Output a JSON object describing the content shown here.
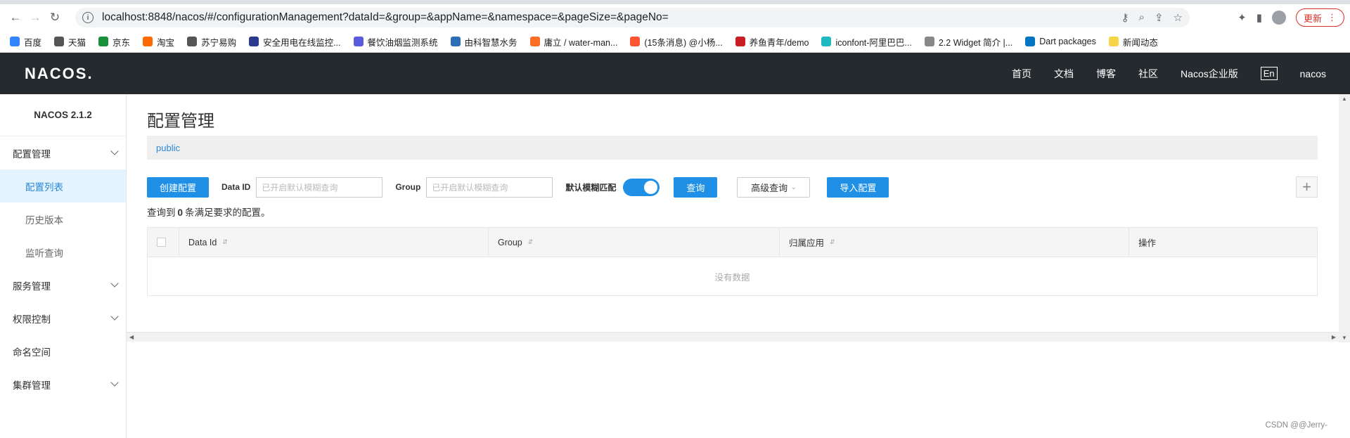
{
  "browser": {
    "url": "localhost:8848/nacos/#/configurationManagement?dataId=&group=&appName=&namespace=&pageSize=&pageNo=",
    "update_label": "更新",
    "bookmarks": [
      {
        "label": "百度",
        "color": "#3385ff"
      },
      {
        "label": "天猫",
        "color": "#555555"
      },
      {
        "label": "京东",
        "color": "#1a8f3c"
      },
      {
        "label": "淘宝",
        "color": "#ff6a00"
      },
      {
        "label": "苏宁易购",
        "color": "#555555"
      },
      {
        "label": "安全用电在线监控...",
        "color": "#2a3a8c"
      },
      {
        "label": "餐饮油烟监测系统",
        "color": "#5a5adc"
      },
      {
        "label": "由科智慧水务",
        "color": "#2a6fb8"
      },
      {
        "label": "庸立 / water-man...",
        "color": "#fc6d26"
      },
      {
        "label": "(15条消息) @小杨...",
        "color": "#fc5531"
      },
      {
        "label": "养鱼青年/demo",
        "color": "#c71d23"
      },
      {
        "label": "iconfont-阿里巴巴...",
        "color": "#1fb8c3"
      },
      {
        "label": "2.2 Widget 简介 |...",
        "color": "#888888"
      },
      {
        "label": "Dart packages",
        "color": "#0175c2"
      },
      {
        "label": "新闻动态",
        "color": "#f5d547"
      }
    ]
  },
  "header": {
    "logo": "NACOS.",
    "nav": [
      "首页",
      "文档",
      "博客",
      "社区",
      "Nacos企业版"
    ],
    "lang": "En",
    "user": "nacos"
  },
  "sidebar": {
    "version": "NACOS 2.1.2",
    "items": [
      {
        "label": "配置管理",
        "expandable": true
      },
      {
        "label": "配置列表",
        "sub": true,
        "active": true
      },
      {
        "label": "历史版本",
        "sub": true
      },
      {
        "label": "监听查询",
        "sub": true
      },
      {
        "label": "服务管理",
        "expandable": true
      },
      {
        "label": "权限控制",
        "expandable": true
      },
      {
        "label": "命名空间"
      },
      {
        "label": "集群管理",
        "expandable": true
      }
    ]
  },
  "main": {
    "title": "配置管理",
    "namespace": "public",
    "create_btn": "创建配置",
    "dataid_label": "Data ID",
    "dataid_placeholder": "已开启默认模糊查询",
    "group_label": "Group",
    "group_placeholder": "已开启默认模糊查询",
    "fuzzy_label": "默认模糊匹配",
    "fuzzy_on": true,
    "query_btn": "查询",
    "advanced_btn": "高级查询",
    "import_btn": "导入配置",
    "result_prefix": "查询到",
    "result_count": "0",
    "result_suffix": "条满足要求的配置。",
    "columns": [
      "Data Id",
      "Group",
      "归属应用",
      "操作"
    ],
    "empty_text": "没有数据"
  },
  "watermark": "CSDN @@Jerry-",
  "colors": {
    "primary": "#1f90e6",
    "header_bg": "#252a2f",
    "active_bg": "#e4f3fe"
  }
}
